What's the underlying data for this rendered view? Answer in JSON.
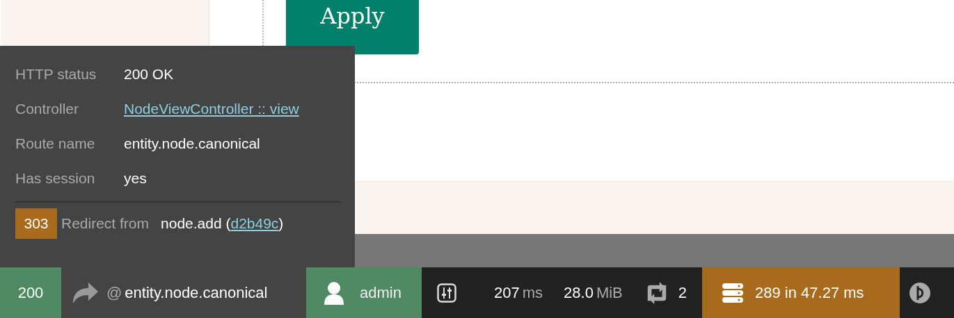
{
  "apply_button": {
    "label": "Apply"
  },
  "request_panel": {
    "rows": [
      {
        "label": "HTTP status",
        "value": "200 OK"
      },
      {
        "label": "Controller",
        "link": "NodeViewController :: view"
      },
      {
        "label": "Route name",
        "value": "entity.node.canonical"
      },
      {
        "label": "Has session",
        "value": "yes"
      }
    ],
    "redirect": {
      "code": "303",
      "label": "Redirect from",
      "before": "node.add (",
      "token": "d2b49c",
      "after": ")"
    }
  },
  "toolbar": {
    "items": [
      {
        "kind": "status",
        "color": "#4f8a62",
        "text": "200"
      },
      {
        "kind": "request",
        "expanded": true,
        "prefix": "@",
        "text": "entity.node.canonical"
      },
      {
        "kind": "user",
        "color": "#4f8a62",
        "text": "admin"
      },
      {
        "kind": "config"
      },
      {
        "kind": "time",
        "value": "207",
        "unit": "ms"
      },
      {
        "kind": "memory",
        "value": "28.0",
        "unit": "MiB"
      },
      {
        "kind": "ajax",
        "text": "2"
      },
      {
        "kind": "db",
        "color": "#a86a1c",
        "text": "289 in 47.27 ms"
      },
      {
        "kind": "more"
      }
    ]
  }
}
